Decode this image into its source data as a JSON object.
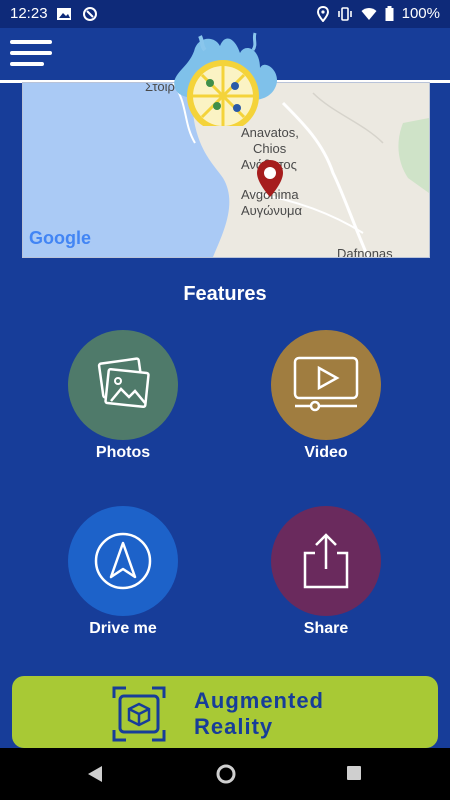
{
  "status_bar": {
    "time": "12:23",
    "battery": "100%",
    "left_icons": [
      "image-icon",
      "at-circle-icon"
    ],
    "right_icons": [
      "location-icon",
      "vibrate-icon",
      "wifi-icon",
      "battery-icon"
    ]
  },
  "header": {
    "menu_icon": "hamburger-menu-icon",
    "logo": "lemon-splash-logo"
  },
  "map": {
    "labels": {
      "stoiri": "Στοιρ",
      "anavatos": "Anavatos,",
      "chios": "Chios",
      "anavatos_greek": "Ανάβατος",
      "avgonima": "Avgonima",
      "avgonima_greek": "Αυγώνυμα",
      "dafnonas": "Dafnonas"
    },
    "attribution": "Google",
    "marker_icon": "map-pin-icon"
  },
  "features": {
    "title": "Features",
    "items": [
      {
        "label": "Photos",
        "icon": "photos-icon",
        "color": "#4f7a6a"
      },
      {
        "label": "Video",
        "icon": "video-player-icon",
        "color": "#a07d40"
      },
      {
        "label": "Drive me",
        "icon": "navigation-arrow-icon",
        "color": "#1d62c9"
      },
      {
        "label": "Share",
        "icon": "share-icon",
        "color": "#6a2a5d"
      }
    ]
  },
  "ar_banner": {
    "line1": "Augmented",
    "line2": "Reality",
    "icon": "ar-cube-icon",
    "color": "#a8c935"
  },
  "nav_bar": {
    "back": "back-triangle-icon",
    "home": "home-circle-icon",
    "recents": "recents-square-icon"
  }
}
